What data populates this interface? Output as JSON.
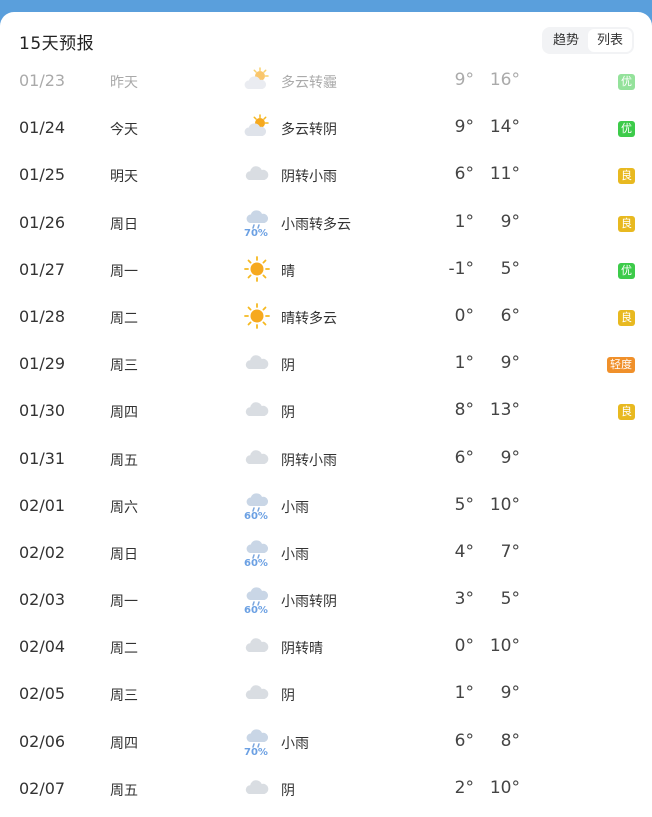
{
  "forecast": {
    "title": "15天预报",
    "toggle": {
      "trend": "趋势",
      "list": "列表",
      "active": "list"
    },
    "days": [
      {
        "date": "01/23",
        "day": "昨天",
        "icon": "partly-cloudy-icon",
        "pct": "",
        "cond": "多云转霾",
        "low": "9°",
        "high": "16°",
        "aqi": "优",
        "aqi_color": "#3dcb4a",
        "past": true
      },
      {
        "date": "01/24",
        "day": "今天",
        "icon": "partly-cloudy-icon",
        "pct": "",
        "cond": "多云转阴",
        "low": "9°",
        "high": "14°",
        "aqi": "优",
        "aqi_color": "#3dcb4a",
        "past": false
      },
      {
        "date": "01/25",
        "day": "明天",
        "icon": "cloud-icon",
        "pct": "",
        "cond": "阴转小雨",
        "low": "6°",
        "high": "11°",
        "aqi": "良",
        "aqi_color": "#e8b920",
        "past": false
      },
      {
        "date": "01/26",
        "day": "周日",
        "icon": "rain-icon",
        "pct": "70%",
        "cond": "小雨转多云",
        "low": "1°",
        "high": "9°",
        "aqi": "良",
        "aqi_color": "#e8b920",
        "past": false
      },
      {
        "date": "01/27",
        "day": "周一",
        "icon": "sun-icon",
        "pct": "",
        "cond": "晴",
        "low": "-1°",
        "high": "5°",
        "aqi": "优",
        "aqi_color": "#3dcb4a",
        "past": false
      },
      {
        "date": "01/28",
        "day": "周二",
        "icon": "sun-icon",
        "pct": "",
        "cond": "晴转多云",
        "low": "0°",
        "high": "6°",
        "aqi": "良",
        "aqi_color": "#e8b920",
        "past": false
      },
      {
        "date": "01/29",
        "day": "周三",
        "icon": "cloud-icon",
        "pct": "",
        "cond": "阴",
        "low": "1°",
        "high": "9°",
        "aqi": "轻度",
        "aqi_color": "#f0902a",
        "past": false
      },
      {
        "date": "01/30",
        "day": "周四",
        "icon": "cloud-icon",
        "pct": "",
        "cond": "阴",
        "low": "8°",
        "high": "13°",
        "aqi": "良",
        "aqi_color": "#e8b920",
        "past": false
      },
      {
        "date": "01/31",
        "day": "周五",
        "icon": "cloud-icon",
        "pct": "",
        "cond": "阴转小雨",
        "low": "6°",
        "high": "9°",
        "aqi": "",
        "aqi_color": "",
        "past": false
      },
      {
        "date": "02/01",
        "day": "周六",
        "icon": "rain-icon",
        "pct": "60%",
        "cond": "小雨",
        "low": "5°",
        "high": "10°",
        "aqi": "",
        "aqi_color": "",
        "past": false
      },
      {
        "date": "02/02",
        "day": "周日",
        "icon": "rain-icon",
        "pct": "60%",
        "cond": "小雨",
        "low": "4°",
        "high": "7°",
        "aqi": "",
        "aqi_color": "",
        "past": false
      },
      {
        "date": "02/03",
        "day": "周一",
        "icon": "rain-icon",
        "pct": "60%",
        "cond": "小雨转阴",
        "low": "3°",
        "high": "5°",
        "aqi": "",
        "aqi_color": "",
        "past": false
      },
      {
        "date": "02/04",
        "day": "周二",
        "icon": "cloud-icon",
        "pct": "",
        "cond": "阴转晴",
        "low": "0°",
        "high": "10°",
        "aqi": "",
        "aqi_color": "",
        "past": false
      },
      {
        "date": "02/05",
        "day": "周三",
        "icon": "cloud-icon",
        "pct": "",
        "cond": "阴",
        "low": "1°",
        "high": "9°",
        "aqi": "",
        "aqi_color": "",
        "past": false
      },
      {
        "date": "02/06",
        "day": "周四",
        "icon": "rain-icon",
        "pct": "70%",
        "cond": "小雨",
        "low": "6°",
        "high": "8°",
        "aqi": "",
        "aqi_color": "",
        "past": false
      },
      {
        "date": "02/07",
        "day": "周五",
        "icon": "cloud-icon",
        "pct": "",
        "cond": "阴",
        "low": "2°",
        "high": "10°",
        "aqi": "",
        "aqi_color": "",
        "past": false
      }
    ]
  }
}
